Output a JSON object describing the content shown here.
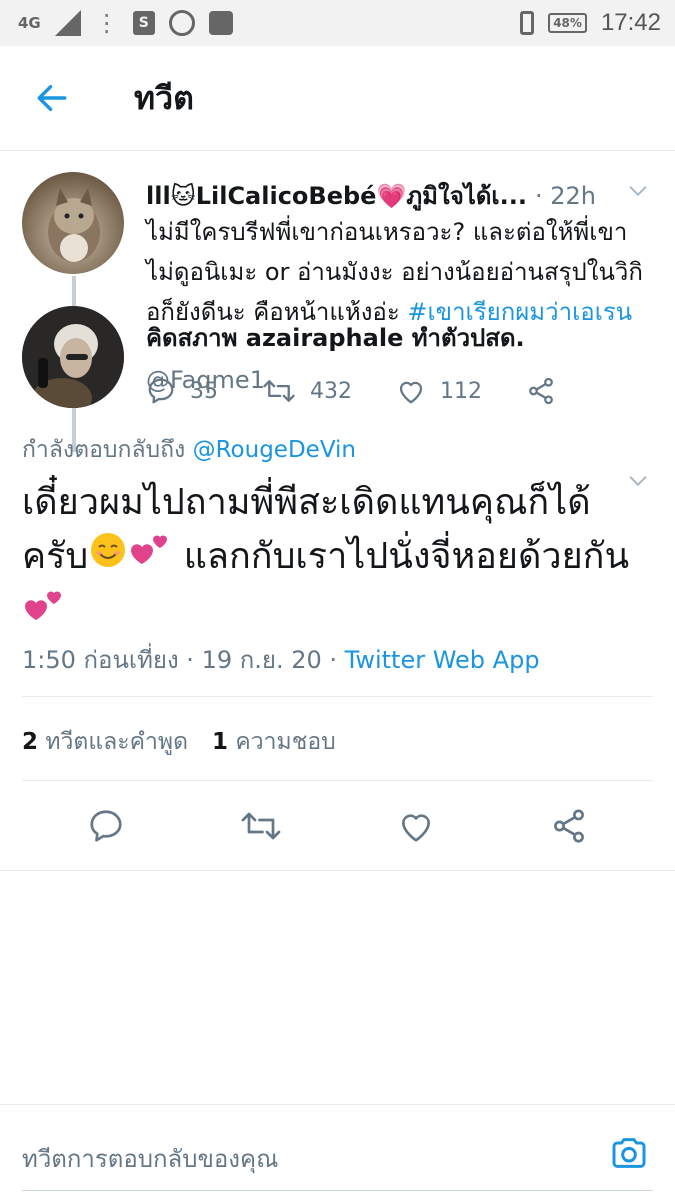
{
  "status_bar": {
    "network": "4G",
    "sim": "1",
    "battery": "48%",
    "time": "17:42"
  },
  "header": {
    "title": "ทวีต"
  },
  "parent_tweet": {
    "name": "lll🐱LilCalicoBebé💗ภูมิใจได้เ...",
    "time": "· 22h",
    "text": "ไม่มีใครบรีฟพี่เขาก่อนเหรอวะ? และต่อให้พี่เขาไม่ดูอนิเมะ or อ่านมังงะ อย่างน้อยอ่านสรุปในวิกิอก็ยังดีนะ คือหน้าแห้งอ่ะ ",
    "hashtag": "#เขาเรียกผมว่าเอเรน",
    "replies": "35",
    "retweets": "432",
    "likes": "112"
  },
  "main_tweet": {
    "name": "คิดสภาพ azairaphale ทำตัวปสด.",
    "handle": "@Faqme1",
    "replying_prefix": "กำลังตอบกลับถึง",
    "replying_to": "@RougeDeVin",
    "text_part1": "เดี๋ยวผมไปถามพี่พีสะเดิดแทนคุณก็ได้ครับ",
    "text_part2": " แลกกับเราไปนั่งจี่หอยด้วยกัน ",
    "text_glyph": "",
    "time": "1:50 ก่อนเที่ยง · 19 ก.ย. 20 · ",
    "source": "Twitter Web App",
    "retweet_count": "2",
    "retweet_label": "ทวีตและคำพูด",
    "like_count": "1",
    "like_label": "ความชอบ"
  },
  "reply_bar": {
    "placeholder": "ทวีตการตอบกลับของคุณ"
  },
  "colors": {
    "accent": "#1b95e0",
    "muted": "#657786",
    "text": "#14171a"
  }
}
